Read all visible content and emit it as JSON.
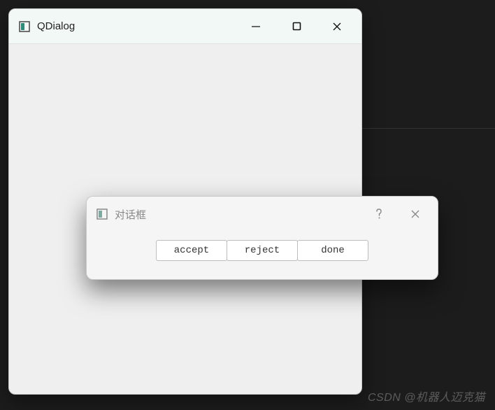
{
  "main_window": {
    "title": "QDialog"
  },
  "dialog_window": {
    "title": "对话框",
    "buttons": {
      "accept": "accept",
      "reject": "reject",
      "done": "done"
    }
  },
  "watermark": "CSDN @机器人迈克猫"
}
